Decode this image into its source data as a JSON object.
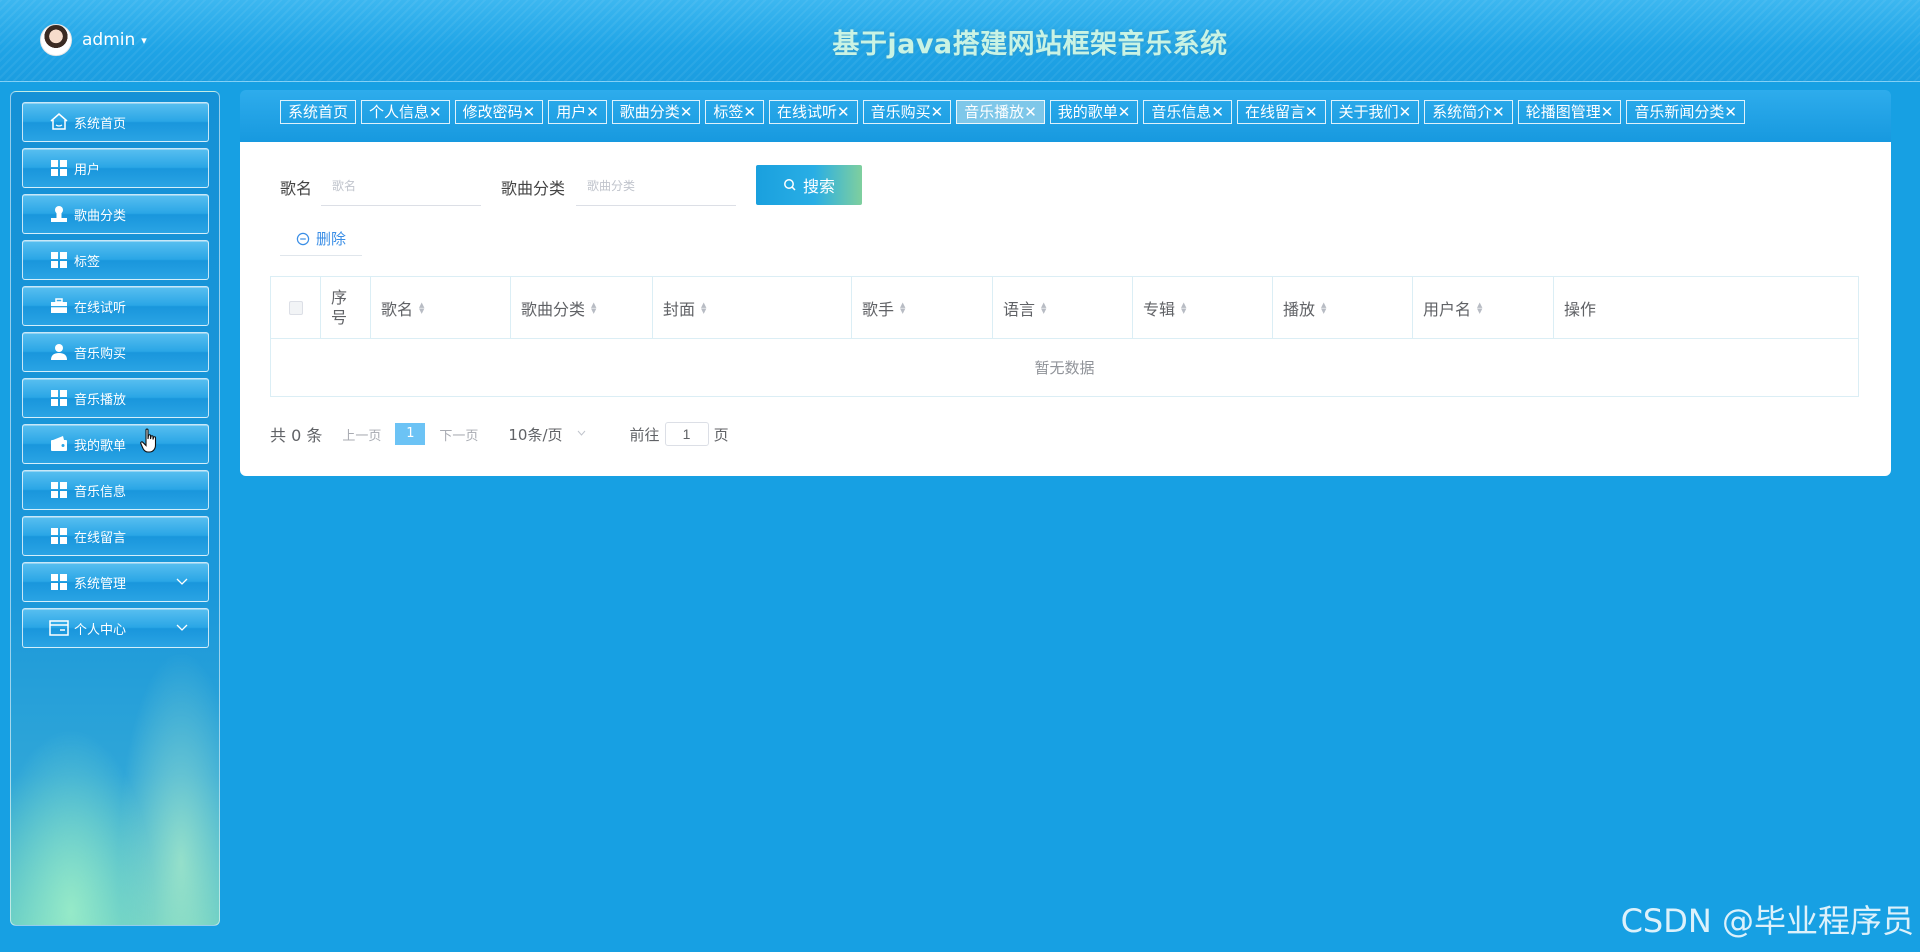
{
  "header": {
    "user_name": "admin",
    "caret": "▾",
    "site_title": "基于java搭建网站框架音乐系统"
  },
  "sidebar": {
    "items": [
      {
        "label": "系统首页",
        "icon": "home-icon"
      },
      {
        "label": "用户",
        "icon": "grid-icon"
      },
      {
        "label": "歌曲分类",
        "icon": "user-stamp-icon"
      },
      {
        "label": "标签",
        "icon": "grid-icon"
      },
      {
        "label": "在线试听",
        "icon": "briefcase-icon"
      },
      {
        "label": "音乐购买",
        "icon": "user-icon"
      },
      {
        "label": "音乐播放",
        "icon": "grid-icon"
      },
      {
        "label": "我的歌单",
        "icon": "wallet-icon"
      },
      {
        "label": "音乐信息",
        "icon": "grid-icon"
      },
      {
        "label": "在线留言",
        "icon": "grid-icon"
      },
      {
        "label": "系统管理",
        "icon": "grid-icon",
        "expandable": true
      },
      {
        "label": "个人中心",
        "icon": "card-icon",
        "expandable": true
      }
    ]
  },
  "tabs": [
    {
      "label": "系统首页",
      "closable": false
    },
    {
      "label": "个人信息",
      "closable": true
    },
    {
      "label": "修改密码",
      "closable": true
    },
    {
      "label": "用户",
      "closable": true
    },
    {
      "label": "歌曲分类",
      "closable": true
    },
    {
      "label": "标签",
      "closable": true
    },
    {
      "label": "在线试听",
      "closable": true
    },
    {
      "label": "音乐购买",
      "closable": true
    },
    {
      "label": "音乐播放",
      "closable": true,
      "active": true
    },
    {
      "label": "我的歌单",
      "closable": true
    },
    {
      "label": "音乐信息",
      "closable": true
    },
    {
      "label": "在线留言",
      "closable": true
    },
    {
      "label": "关于我们",
      "closable": true
    },
    {
      "label": "系统简介",
      "closable": true
    },
    {
      "label": "轮播图管理",
      "closable": true
    },
    {
      "label": "音乐新闻分类",
      "closable": true
    }
  ],
  "close_glyph": "✕",
  "search": {
    "song_label": "歌名",
    "song_placeholder": "歌名",
    "category_label": "歌曲分类",
    "category_placeholder": "歌曲分类",
    "button_label": "搜索"
  },
  "actions": {
    "delete_label": "删除"
  },
  "table": {
    "columns": [
      {
        "label": "",
        "type": "checkbox"
      },
      {
        "label": "序号",
        "sortable": false
      },
      {
        "label": "歌名",
        "sortable": true
      },
      {
        "label": "歌曲分类",
        "sortable": true
      },
      {
        "label": "封面",
        "sortable": true
      },
      {
        "label": "歌手",
        "sortable": true
      },
      {
        "label": "语言",
        "sortable": true
      },
      {
        "label": "专辑",
        "sortable": true
      },
      {
        "label": "播放",
        "sortable": true
      },
      {
        "label": "用户名",
        "sortable": true
      },
      {
        "label": "操作",
        "sortable": false
      }
    ],
    "empty_text": "暂无数据"
  },
  "pagination": {
    "total_text": "共 0 条",
    "prev_label": "上一页",
    "current_page": "1",
    "next_label": "下一页",
    "page_size": "10条/页",
    "goto_label": "前往",
    "goto_value": "1",
    "goto_unit": "页"
  },
  "watermark": "CSDN @毕业程序员",
  "colors": {
    "background": "#17a0e3",
    "active_tab": "#7ec7e9",
    "page_active": "#6cc3f5",
    "title": "#c9f3e4"
  }
}
